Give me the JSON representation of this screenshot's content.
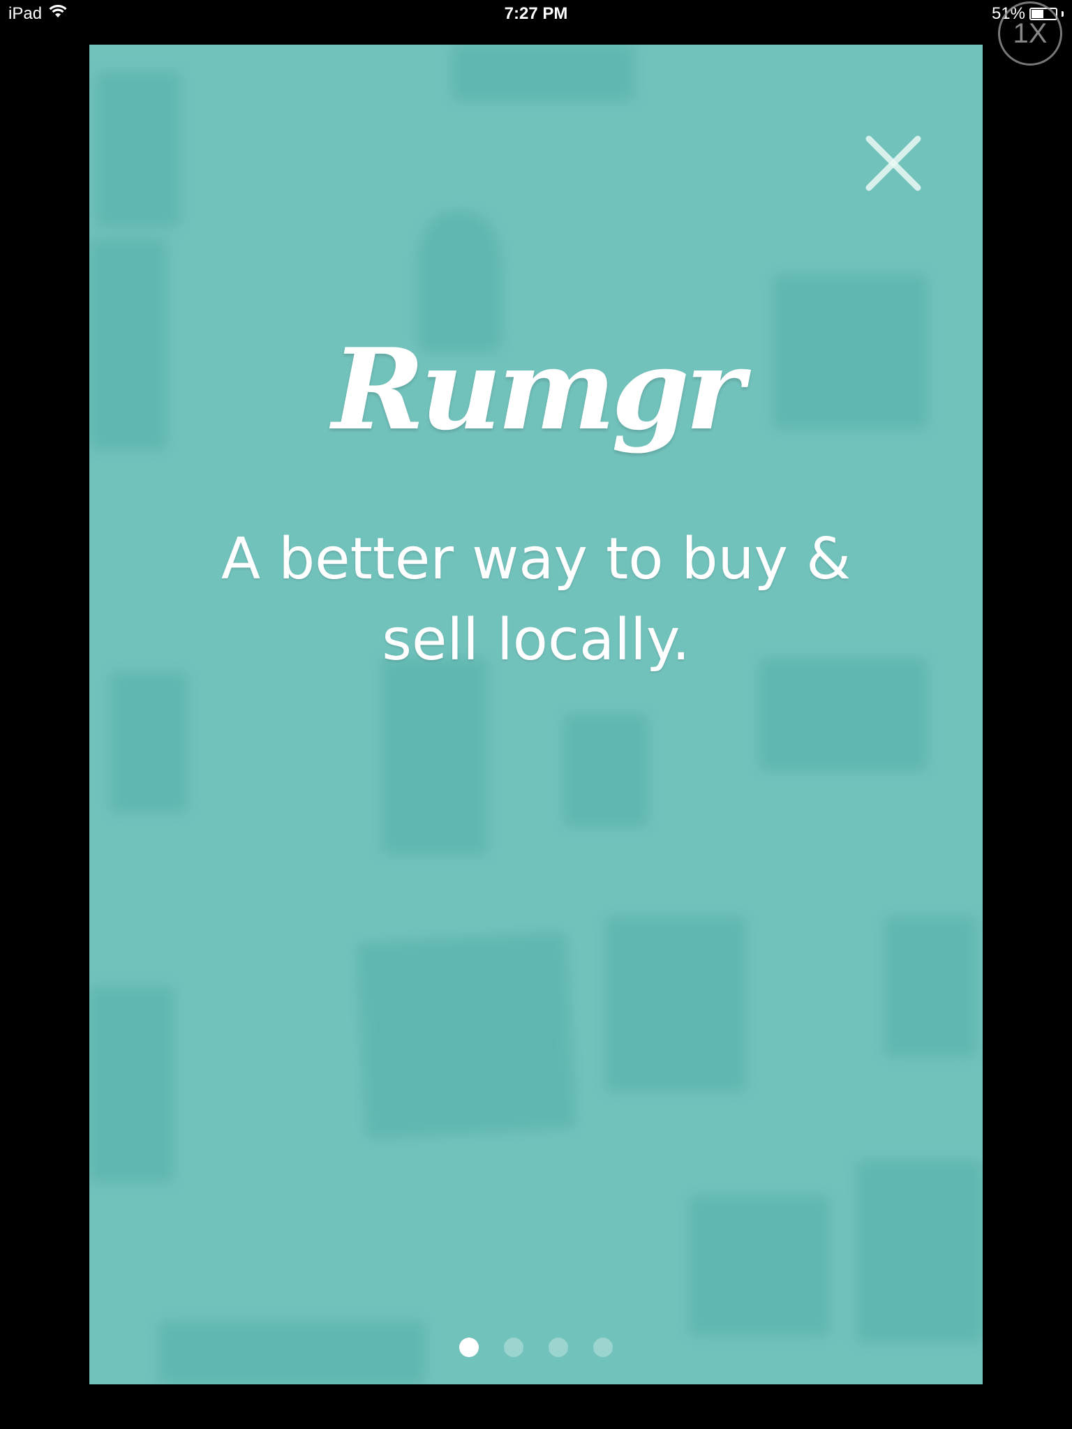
{
  "status_bar": {
    "device": "iPad",
    "time": "7:27 PM",
    "battery_percent": "51%",
    "battery_level": 0.51,
    "wifi_icon": "wifi-icon"
  },
  "zoom_badge": "1X",
  "onboarding": {
    "logo_text": "Rumgr",
    "tagline": "A better way to buy & sell locally.",
    "close_icon": "close-icon",
    "background_color": "#72c2bc",
    "pages": [
      {
        "active": true
      },
      {
        "active": false
      },
      {
        "active": false
      },
      {
        "active": false
      }
    ]
  }
}
